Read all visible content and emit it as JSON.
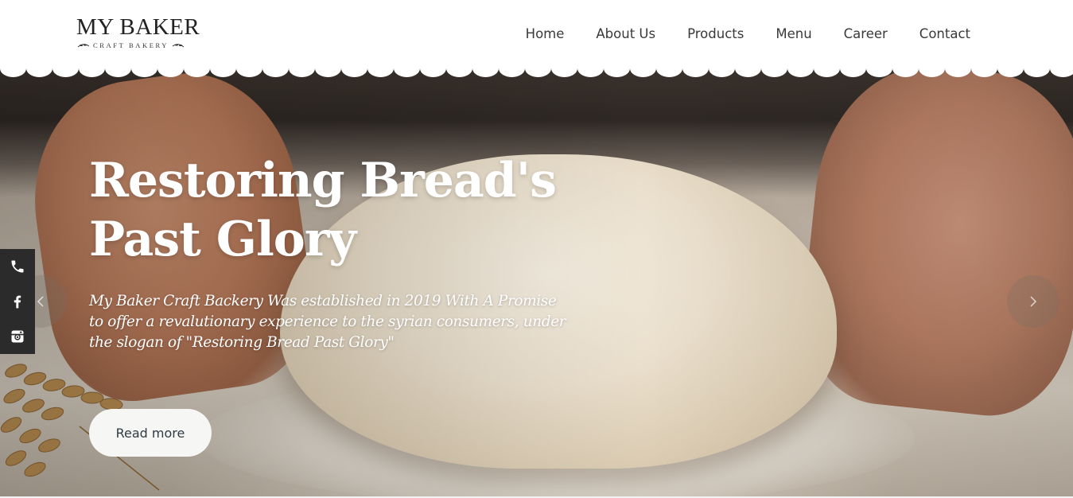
{
  "brand": {
    "name": "MY BAKER",
    "tagline": "CRAFT BAKERY"
  },
  "nav": {
    "items": [
      {
        "label": "Home"
      },
      {
        "label": "About Us"
      },
      {
        "label": "Products"
      },
      {
        "label": "Menu"
      },
      {
        "label": "Career"
      },
      {
        "label": "Contact"
      }
    ]
  },
  "hero": {
    "title_line1": "Restoring Bread's",
    "title_line2": "Past Glory",
    "description": "My Baker Craft Backery Was established in 2019 With A Promise to offer a revalutionary experience to the syrian consumers, under the slogan of \"Restoring Bread Past Glory\"",
    "cta_label": "Read more"
  },
  "slider": {
    "prev_icon": "chevron-left-icon",
    "next_icon": "chevron-right-icon"
  },
  "social": {
    "items": [
      {
        "icon": "phone-icon"
      },
      {
        "icon": "facebook-icon"
      },
      {
        "icon": "instagram-icon"
      }
    ]
  },
  "colors": {
    "header_bg": "#ffffff",
    "nav_text": "#3a3a3a",
    "hero_text": "#ffffff",
    "button_bg": "#f6f6f4",
    "button_text": "#2f3b44",
    "social_bg": "#2b2b2b"
  }
}
